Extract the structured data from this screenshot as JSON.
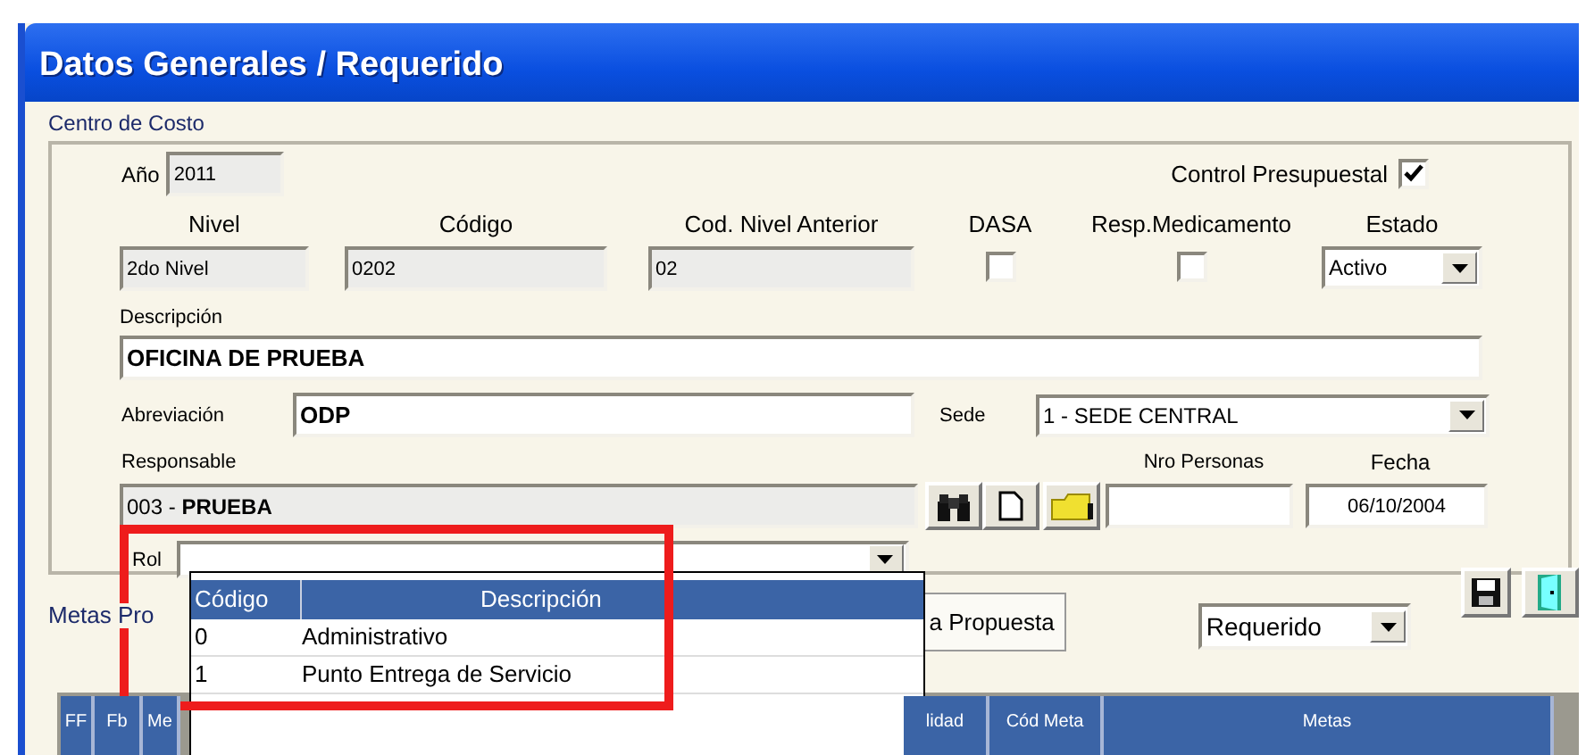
{
  "window": {
    "title": "Datos Generales / Requerido"
  },
  "group": {
    "title": "Centro de Costo"
  },
  "anio": {
    "label": "Año",
    "value": "2011"
  },
  "control_presupuestal": {
    "label": "Control Presupuestal",
    "checked": true
  },
  "fields": [
    {
      "label": "Nivel",
      "value": "2do Nivel",
      "kind": "text"
    },
    {
      "label": "Código",
      "value": "0202",
      "kind": "text"
    },
    {
      "label": "Cod. Nivel Anterior",
      "value": "02",
      "kind": "text"
    },
    {
      "label": "DASA",
      "checked": false,
      "kind": "check"
    },
    {
      "label": "Resp.Medicamento",
      "checked": false,
      "kind": "check"
    },
    {
      "label": "Estado",
      "value": "Activo",
      "kind": "select"
    }
  ],
  "descripcion": {
    "label": "Descripción",
    "value": "OFICINA DE PRUEBA"
  },
  "abreviacion": {
    "label": "Abreviación",
    "value": "ODP"
  },
  "sede": {
    "label": "Sede",
    "value": "1 - SEDE CENTRAL"
  },
  "responsable": {
    "label": "Responsable",
    "value": "003 - **PRUEBA**"
  },
  "nro_personas": {
    "label": "Nro Personas"
  },
  "fecha": {
    "label": "Fecha",
    "value": "06/10/2004"
  },
  "rol": {
    "label": "Rol",
    "dropdown": {
      "columns": [
        "Código",
        "Descripción"
      ],
      "rows": [
        [
          "0",
          "Administrativo"
        ],
        [
          "1",
          "Punto Entrega de Servicio"
        ]
      ]
    }
  },
  "metas": {
    "label": "Metas Pro",
    "button": "a Propuesta",
    "filter": "Requerido",
    "columns": [
      "FF",
      "Fb",
      "Me",
      "lidad",
      "Cód Meta",
      "Metas"
    ]
  }
}
